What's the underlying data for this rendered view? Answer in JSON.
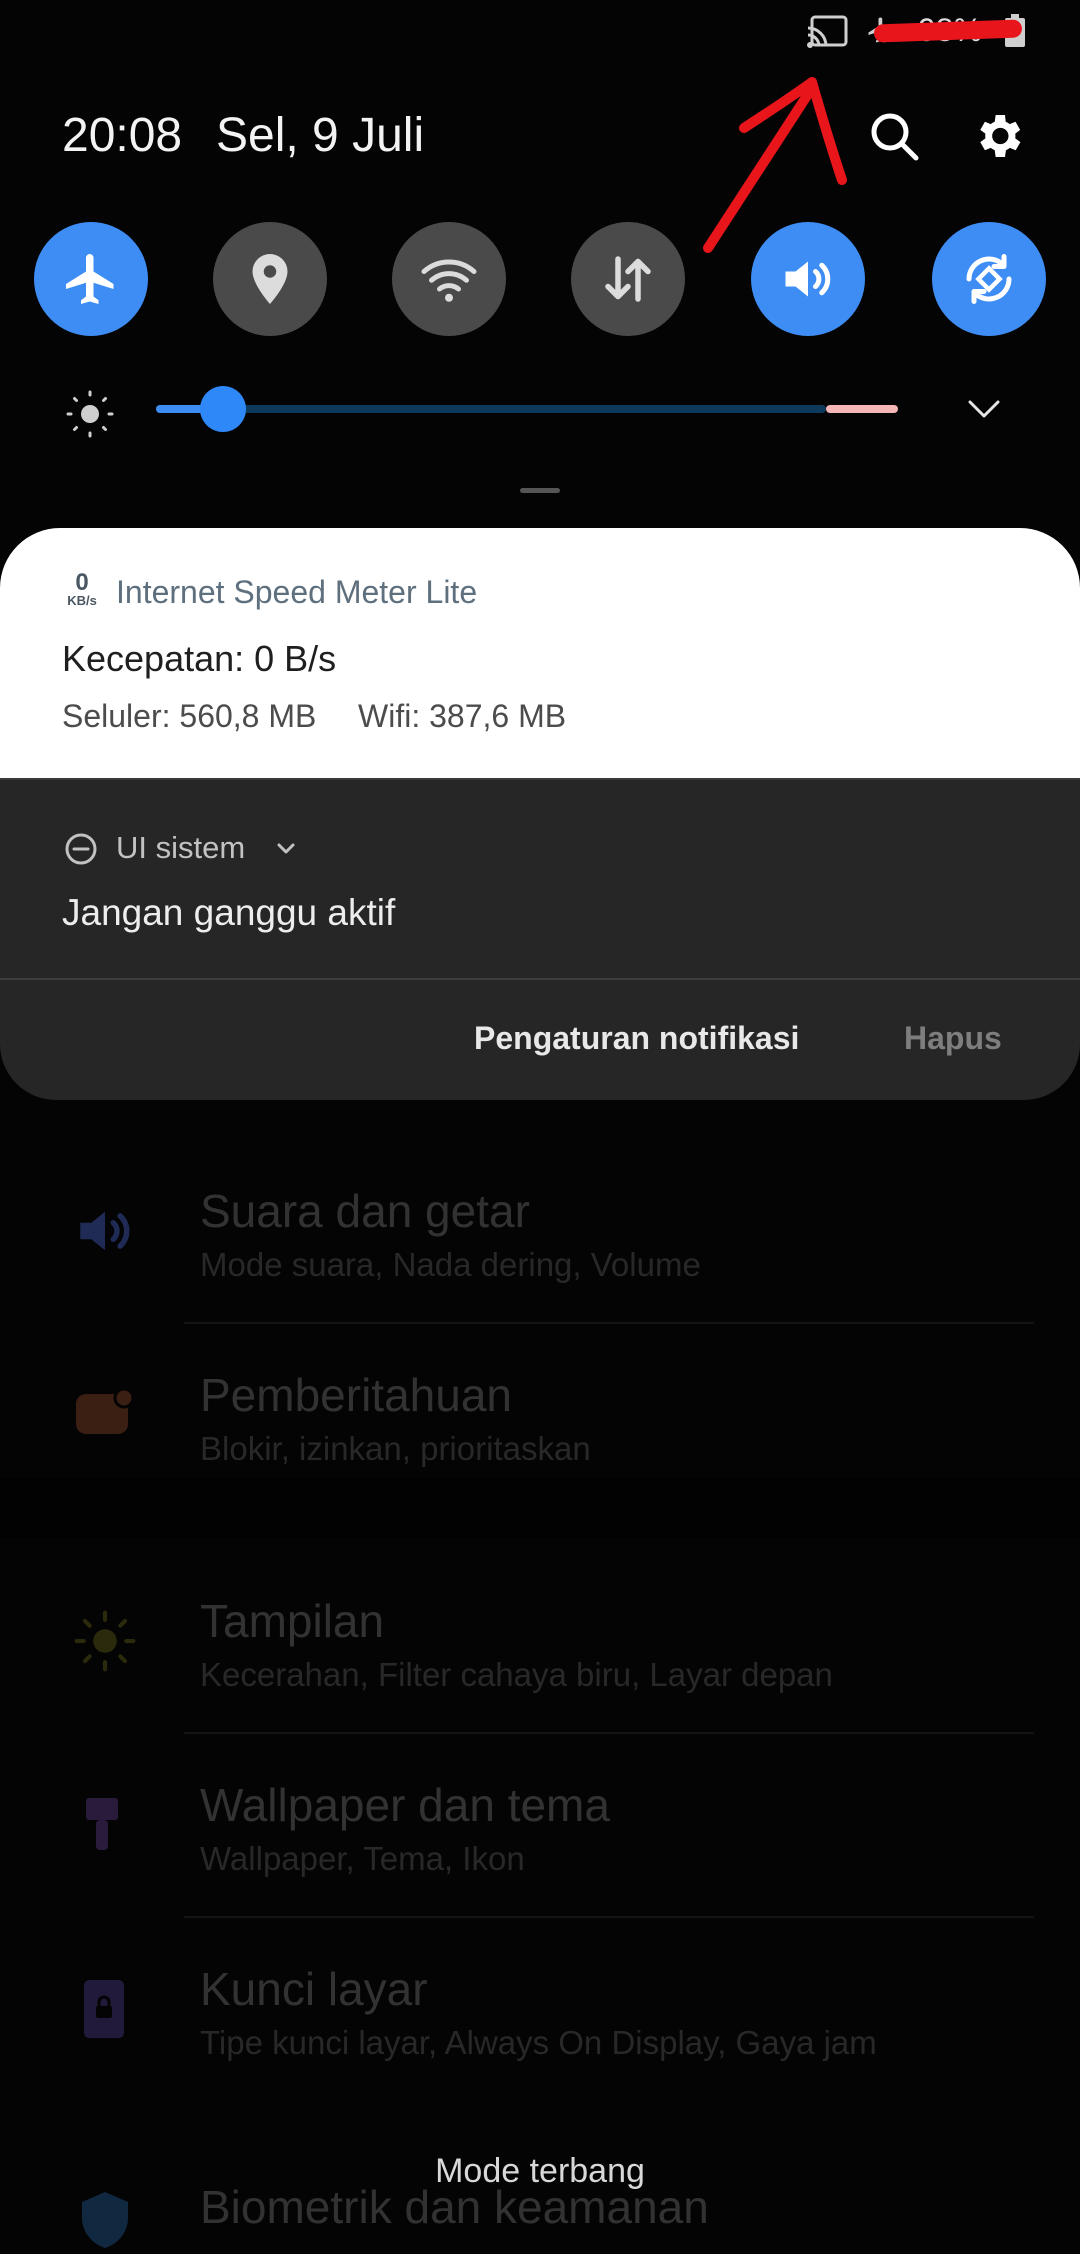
{
  "status_bar": {
    "battery_text": "98%",
    "icons": [
      "cast-icon",
      "airplane-mode-icon",
      "battery-icon"
    ]
  },
  "header": {
    "time": "20:08",
    "date": "Sel, 9 Juli",
    "search_icon": "search-icon",
    "settings_icon": "gear-icon"
  },
  "quick_tiles": [
    {
      "name": "airplane-mode",
      "icon": "airplane-icon",
      "state": "on"
    },
    {
      "name": "location",
      "icon": "location-pin-icon",
      "state": "off"
    },
    {
      "name": "wifi",
      "icon": "wifi-icon",
      "state": "off"
    },
    {
      "name": "mobile-data",
      "icon": "data-transfer-icon",
      "state": "off"
    },
    {
      "name": "sound",
      "icon": "speaker-icon",
      "state": "on"
    },
    {
      "name": "auto-rotate",
      "icon": "rotate-icon",
      "state": "on"
    }
  ],
  "brightness": {
    "level": 0.1
  },
  "notifications": {
    "speed_meter": {
      "icon_number": "0",
      "icon_unit": "KB/s",
      "app_name": "Internet Speed Meter Lite",
      "speed": "Kecepatan: 0 B/s",
      "mobile_usage": "Seluler: 560,8 MB",
      "wifi_usage": "Wifi: 387,6 MB"
    },
    "system_ui": {
      "app_name": "UI sistem",
      "message": "Jangan ganggu aktif"
    },
    "actions": {
      "settings_label": "Pengaturan notifikasi",
      "clear_label": "Hapus"
    }
  },
  "settings_list": [
    {
      "title": "Suara dan getar",
      "subtitle": "Mode suara, Nada dering, Volume",
      "icon": "speaker-icon"
    },
    {
      "title": "Pemberitahuan",
      "subtitle": "Blokir, izinkan, prioritaskan",
      "icon": "notification-badge-icon"
    },
    {
      "title": "Tampilan",
      "subtitle": "Kecerahan, Filter cahaya biru, Layar depan",
      "icon": "sun-icon"
    },
    {
      "title": "Wallpaper dan tema",
      "subtitle": "Wallpaper, Tema, Ikon",
      "icon": "brush-icon"
    },
    {
      "title": "Kunci layar",
      "subtitle": "Tipe kunci layar, Always On Display, Gaya jam",
      "icon": "lock-icon"
    },
    {
      "title": "Biometrik dan keamanan",
      "subtitle": "",
      "icon": "shield-icon"
    }
  ],
  "toast": "Mode terbang",
  "colors": {
    "accent": "#3d8df5",
    "tile_off": "#4a4a4a",
    "annotation": "#e8151b"
  }
}
